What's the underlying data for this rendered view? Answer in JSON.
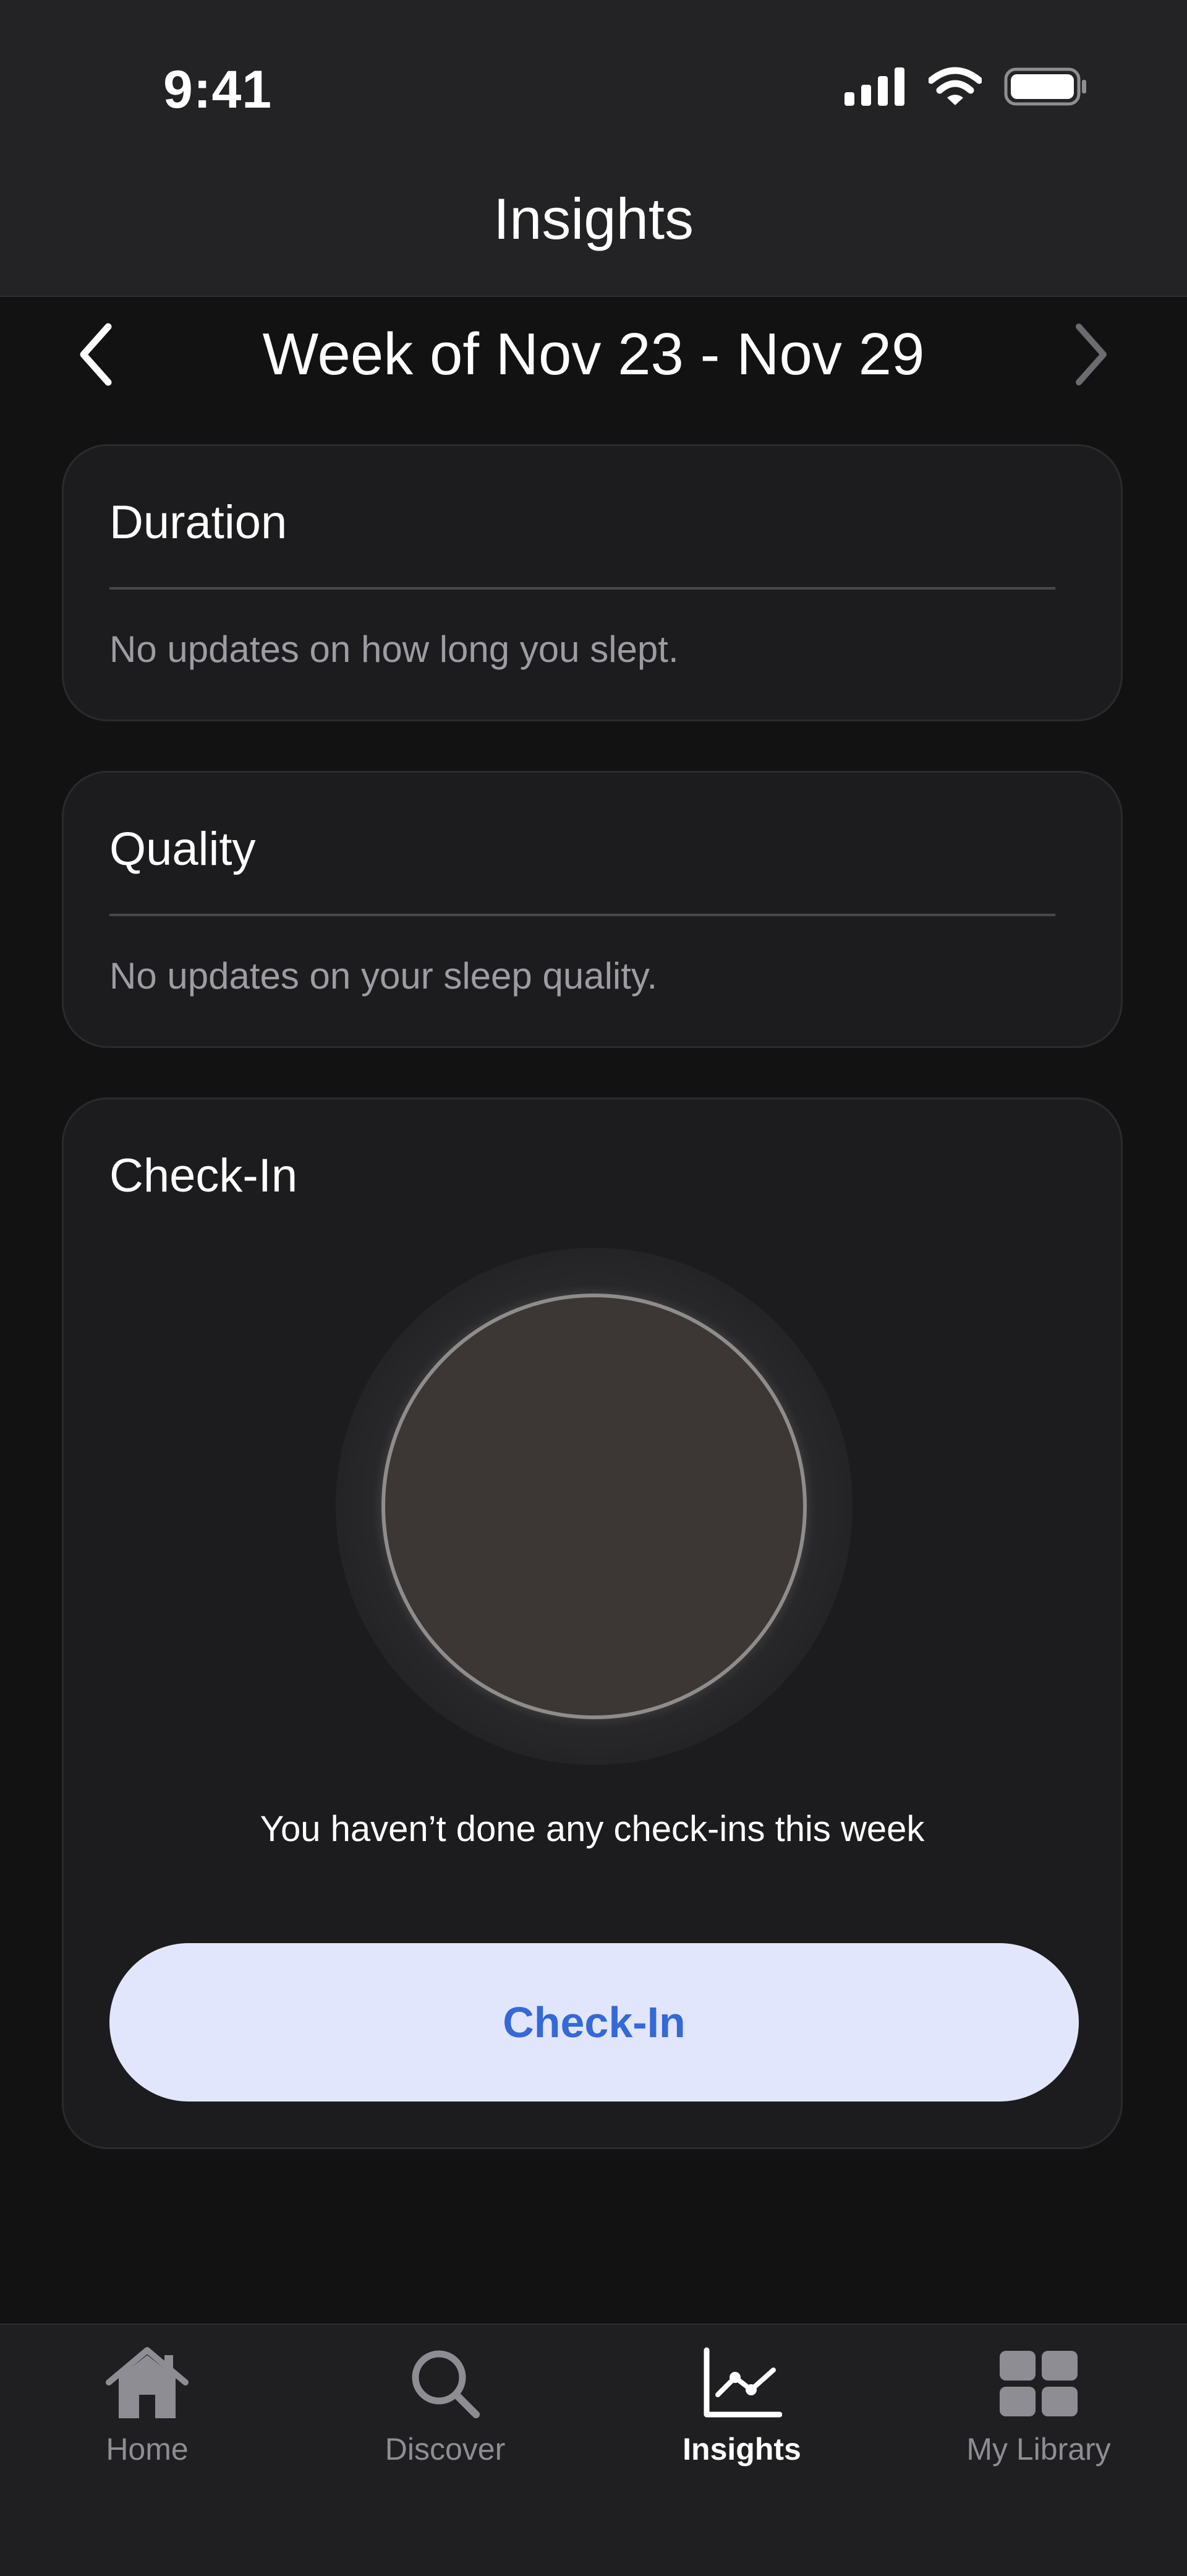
{
  "status_bar": {
    "time": "9:41",
    "icons": [
      "cellular-signal-icon",
      "wifi-icon",
      "battery-icon"
    ]
  },
  "header": {
    "title": "Insights"
  },
  "week_nav": {
    "label": "Week of Nov 23 - Nov 29",
    "prev_icon": "chevron-left-icon",
    "next_icon": "chevron-right-icon"
  },
  "cards": {
    "duration": {
      "title": "Duration",
      "message": "No updates on how long you slept."
    },
    "quality": {
      "title": "Quality",
      "message": "No updates on your sleep quality."
    },
    "checkin": {
      "title": "Check-In",
      "message": "You haven’t done any check-ins this week",
      "button_label": "Check-In"
    }
  },
  "tabbar": {
    "items": [
      {
        "label": "Home",
        "icon": "home-icon",
        "active": false
      },
      {
        "label": "Discover",
        "icon": "search-icon",
        "active": false
      },
      {
        "label": "Insights",
        "icon": "chart-line-icon",
        "active": true
      },
      {
        "label": "My Library",
        "icon": "grid-icon",
        "active": false
      }
    ]
  },
  "colors": {
    "background": "#121212",
    "card": "#1c1c1e",
    "accent_button_bg": "#e2e6fc",
    "accent_button_text": "#3469d6",
    "muted_text": "#9c9ca2",
    "inactive_tab": "#8d8d93"
  }
}
